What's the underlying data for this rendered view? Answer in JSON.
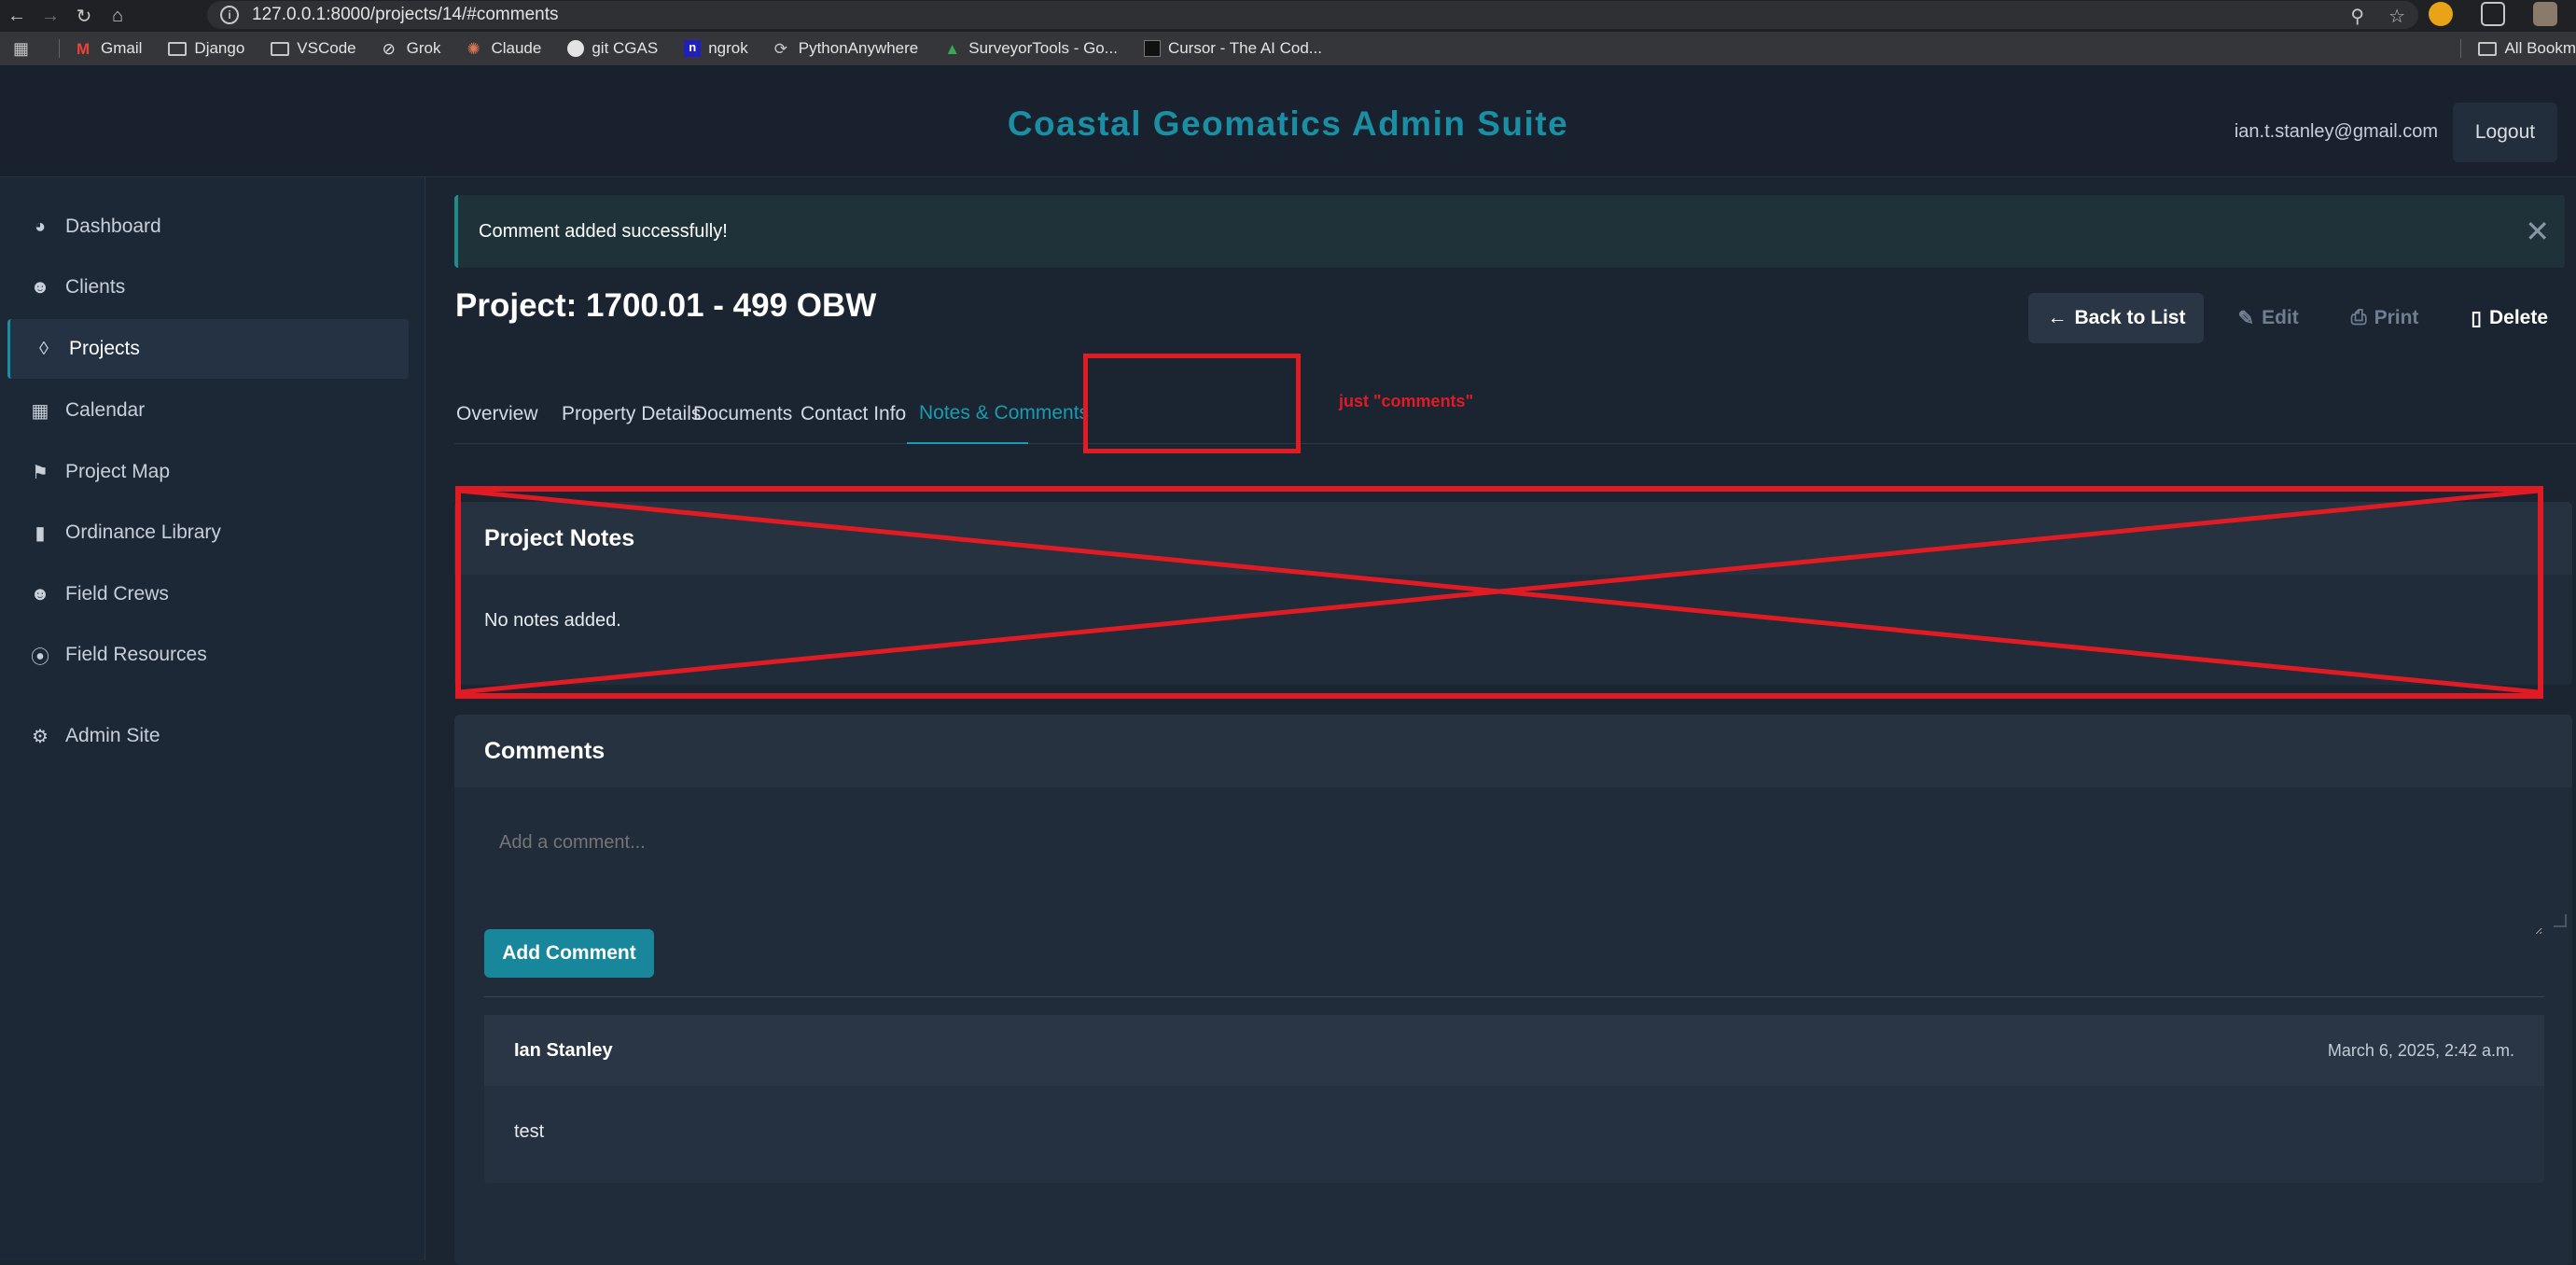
{
  "browser": {
    "url": "127.0.0.1:8000/projects/14/#comments",
    "bookmarks": [
      "Gmail",
      "Django",
      "VSCode",
      "Grok",
      "Claude",
      "git CGAS",
      "ngrok",
      "PythonAnywhere",
      "SurveyorTools - Go...",
      "Cursor - The AI Cod..."
    ],
    "all_bookmarks": "All Bookm"
  },
  "header": {
    "title": "Coastal Geomatics Admin Suite",
    "user_email": "ian.t.stanley@gmail.com",
    "logout_label": "Logout"
  },
  "sidebar": {
    "items": [
      {
        "label": "Dashboard",
        "icon": "dashboard-icon"
      },
      {
        "label": "Clients",
        "icon": "users-icon"
      },
      {
        "label": "Projects",
        "icon": "project-diagram-icon"
      },
      {
        "label": "Calendar",
        "icon": "calendar-icon"
      },
      {
        "label": "Project Map",
        "icon": "map-icon"
      },
      {
        "label": "Ordinance Library",
        "icon": "book-icon"
      },
      {
        "label": "Field Crews",
        "icon": "users-icon"
      },
      {
        "label": "Field Resources",
        "icon": "compass-icon"
      },
      {
        "label": "Admin Site",
        "icon": "gear-icon"
      }
    ],
    "active": "Projects"
  },
  "alert": {
    "message": "Comment added successfully!"
  },
  "page": {
    "title": "Project: 1700.01 - 499 OBW",
    "actions": {
      "back": "Back to List",
      "edit": "Edit",
      "print": "Print",
      "delete": "Delete"
    }
  },
  "tabs": [
    {
      "label": "Overview"
    },
    {
      "label": "Property Details"
    },
    {
      "label": "Documents"
    },
    {
      "label": "Contact Info"
    },
    {
      "label": "Notes & Comments"
    }
  ],
  "active_tab": "Notes & Comments",
  "annotation": {
    "note": "just \"comments\"",
    "color": "#e01b24"
  },
  "notes_card": {
    "title": "Project Notes",
    "body": "No notes added."
  },
  "comments_card": {
    "title": "Comments",
    "placeholder": "Add a comment...",
    "add_button": "Add Comment",
    "items": [
      {
        "author": "Ian Stanley",
        "date": "March 6, 2025, 2:42 a.m.",
        "text": "test"
      }
    ]
  },
  "colors": {
    "accent": "#1a8fa3",
    "background": "#1b2431",
    "annotation_red": "#e01b24"
  }
}
